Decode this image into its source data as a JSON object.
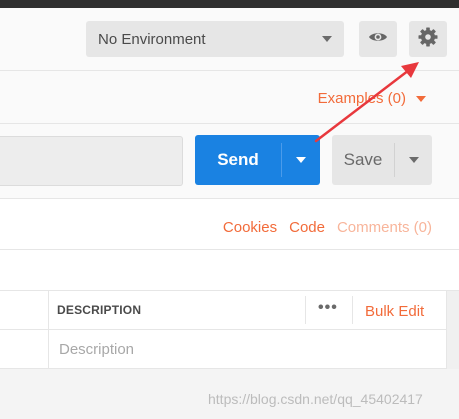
{
  "header": {
    "environment_selected": "No Environment"
  },
  "examples": {
    "label": "Examples (0)"
  },
  "request": {
    "send_label": "Send",
    "save_label": "Save"
  },
  "links": {
    "cookies": "Cookies",
    "code": "Code",
    "comments": "Comments (0)"
  },
  "params_table": {
    "column_description": "DESCRIPTION",
    "more_glyph": "•••",
    "bulk_edit": "Bulk Edit",
    "description_placeholder": "Description"
  },
  "watermark": "https://blog.csdn.net/qq_45402417",
  "icons": {
    "eye": "eye-icon",
    "gear": "gear-icon",
    "arrow": "red-arrow-annotation"
  },
  "colors": {
    "accent_orange": "#f26b3a",
    "send_blue": "#1a82e2",
    "annotation_red": "#e8383d"
  }
}
